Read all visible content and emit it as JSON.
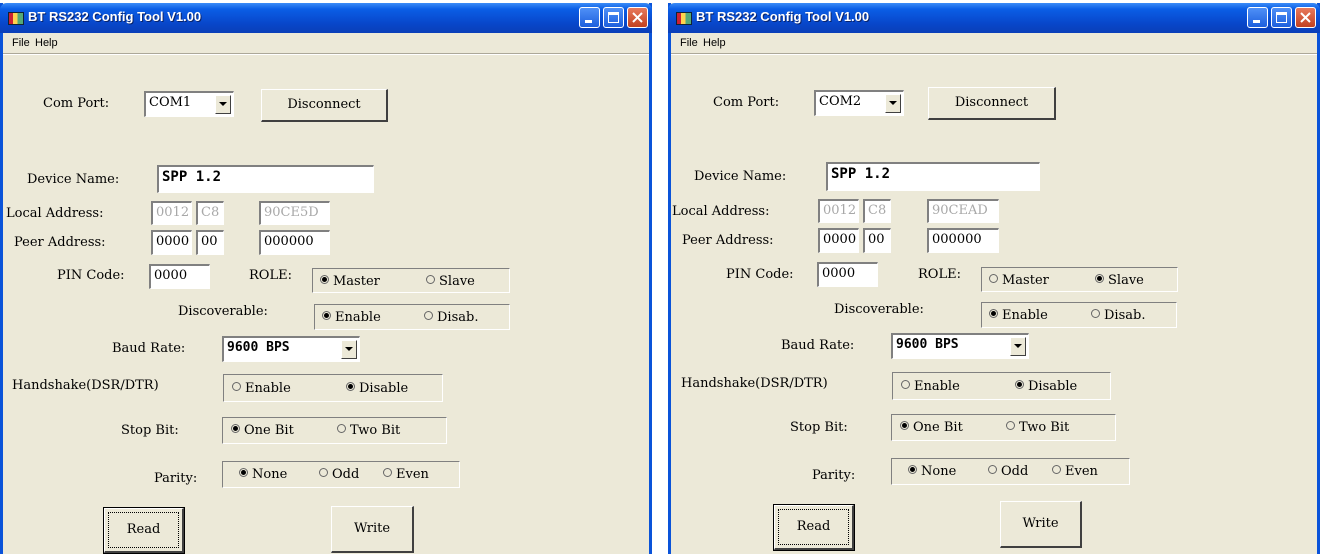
{
  "windows": [
    {
      "title": "BT RS232 Config Tool  V1.00",
      "menu": [
        "File",
        "Help"
      ],
      "com_port_label": "Com Port:",
      "com_port_value": "COM1",
      "disconnect_label": "Disconnect",
      "device_name_label": "Device Name:",
      "device_name_value": "SPP 1.2",
      "local_address_label": "Local Address:",
      "local_address": [
        "0012",
        "C8",
        "90CE5D"
      ],
      "peer_address_label": "Peer Address:",
      "peer_address": [
        "0000",
        "00",
        "000000"
      ],
      "pin_code_label": "PIN Code:",
      "pin_code_value": "0000",
      "role_label": "ROLE:",
      "role_options": [
        "Master",
        "Slave"
      ],
      "role_selected": "Master",
      "discoverable_label": "Discoverable:",
      "discoverable_options": [
        "Enable",
        "Disab."
      ],
      "discoverable_selected": "Enable",
      "baud_rate_label": "Baud Rate:",
      "baud_rate_value": "9600 BPS",
      "handshake_label": "Handshake(DSR/DTR)",
      "handshake_options": [
        "Enable",
        "Disable"
      ],
      "handshake_selected": "Disable",
      "stop_bit_label": "Stop Bit:",
      "stop_bit_options": [
        "One Bit",
        "Two Bit"
      ],
      "stop_bit_selected": "One Bit",
      "parity_label": "Parity:",
      "parity_options": [
        "None",
        "Odd",
        "Even"
      ],
      "parity_selected": "None",
      "read_label": "Read",
      "write_label": "Write"
    },
    {
      "title": "BT RS232 Config Tool  V1.00",
      "menu": [
        "File",
        "Help"
      ],
      "com_port_label": "Com Port:",
      "com_port_value": "COM2",
      "disconnect_label": "Disconnect",
      "device_name_label": "Device Name:",
      "device_name_value": "SPP 1.2",
      "local_address_label": "Local Address:",
      "local_address": [
        "0012",
        "C8",
        "90CEAD"
      ],
      "peer_address_label": "Peer Address:",
      "peer_address": [
        "0000",
        "00",
        "000000"
      ],
      "pin_code_label": "PIN Code:",
      "pin_code_value": "0000",
      "role_label": "ROLE:",
      "role_options": [
        "Master",
        "Slave"
      ],
      "role_selected": "Slave",
      "discoverable_label": "Discoverable:",
      "discoverable_options": [
        "Enable",
        "Disab."
      ],
      "discoverable_selected": "Enable",
      "baud_rate_label": "Baud Rate:",
      "baud_rate_value": "9600 BPS",
      "handshake_label": "Handshake(DSR/DTR)",
      "handshake_options": [
        "Enable",
        "Disable"
      ],
      "handshake_selected": "Disable",
      "stop_bit_label": "Stop Bit:",
      "stop_bit_options": [
        "One Bit",
        "Two Bit"
      ],
      "stop_bit_selected": "One Bit",
      "parity_label": "Parity:",
      "parity_options": [
        "None",
        "Odd",
        "Even"
      ],
      "parity_selected": "None",
      "read_label": "Read",
      "write_label": "Write"
    }
  ],
  "colors": {
    "titlebar": "#0846c9",
    "face": "#ece9d8",
    "close": "#c24020"
  }
}
